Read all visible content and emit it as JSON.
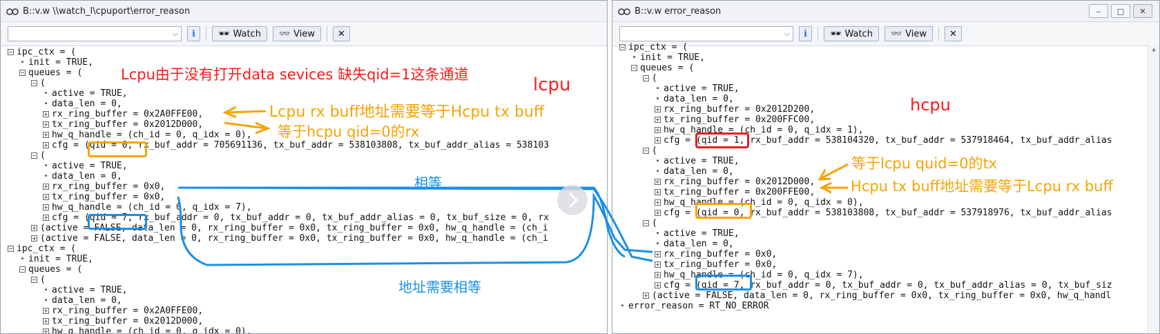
{
  "left_window": {
    "title": "B::v.w \\\\watch_l\\cpuport\\error_reason",
    "toolbar": {
      "watch_label": "Watch",
      "view_label": "View"
    },
    "lines": [
      {
        "d": 0,
        "m": "exp",
        "t": "ipc_ctx = ("
      },
      {
        "d": 1,
        "m": "dot",
        "t": "init = TRUE,"
      },
      {
        "d": 1,
        "m": "exp",
        "t": "queues = ("
      },
      {
        "d": 2,
        "m": "exp",
        "t": "("
      },
      {
        "d": 3,
        "m": "dot",
        "t": "active = TRUE,"
      },
      {
        "d": 3,
        "m": "dot",
        "t": "data_len = 0,"
      },
      {
        "d": 3,
        "m": "col",
        "t": "rx_ring_buffer = 0x2A0FFE00,"
      },
      {
        "d": 3,
        "m": "col",
        "t": "tx_ring_buffer = 0x2012D000,"
      },
      {
        "d": 3,
        "m": "col",
        "t": "hw_q_handle = (ch_id = 0, q_idx = 0),"
      },
      {
        "d": 3,
        "m": "col",
        "t": "cfg = (qid = 0, rx_buf_addr = 705691136, tx_buf_addr = 538103808, tx_buf_addr_alias = 538103"
      },
      {
        "d": 2,
        "m": "exp",
        "t": "("
      },
      {
        "d": 3,
        "m": "dot",
        "t": "active = TRUE,"
      },
      {
        "d": 3,
        "m": "dot",
        "t": "data_len = 0,"
      },
      {
        "d": 3,
        "m": "col",
        "t": "rx_ring_buffer = 0x0,"
      },
      {
        "d": 3,
        "m": "col",
        "t": "tx_ring_buffer = 0x0,"
      },
      {
        "d": 3,
        "m": "col",
        "t": "hw_q_handle = (ch_id = 0, q_idx = 7),"
      },
      {
        "d": 3,
        "m": "col",
        "t": "cfg = (qid = 7, rx_buf_addr = 0, tx_buf_addr = 0, tx_buf_addr_alias = 0, tx_buf_size = 0, rx"
      },
      {
        "d": 2,
        "m": "col",
        "t": "(active = FALSE, data_len = 0, rx_ring_buffer = 0x0, tx_ring_buffer = 0x0, hw_q_handle = (ch_i"
      },
      {
        "d": 2,
        "m": "col",
        "t": "(active = FALSE, data_len = 0, rx_ring_buffer = 0x0, tx_ring_buffer = 0x0, hw_q_handle = (ch_i"
      },
      {
        "d": 0,
        "m": "exp",
        "t": "ipc_ctx = ("
      },
      {
        "d": 1,
        "m": "dot",
        "t": "init = TRUE,"
      },
      {
        "d": 1,
        "m": "exp",
        "t": "queues = ("
      },
      {
        "d": 2,
        "m": "exp",
        "t": "("
      },
      {
        "d": 3,
        "m": "dot",
        "t": "active = TRUE,"
      },
      {
        "d": 3,
        "m": "dot",
        "t": "data_len = 0,"
      },
      {
        "d": 3,
        "m": "col",
        "t": "rx_ring_buffer = 0x2A0FFE00,"
      },
      {
        "d": 3,
        "m": "col",
        "t": "tx_ring_buffer = 0x2012D000,"
      },
      {
        "d": 3,
        "m": "col",
        "t": "hw_q_handle = (ch_id = 0, q_idx = 0),"
      }
    ]
  },
  "right_window": {
    "title": "B::v.w error_reason",
    "toolbar": {
      "watch_label": "Watch",
      "view_label": "View"
    },
    "lines": [
      {
        "d": 0,
        "m": "exp",
        "t": "ipc_ctx = ("
      },
      {
        "d": 1,
        "m": "dot",
        "t": "init = TRUE,"
      },
      {
        "d": 1,
        "m": "exp",
        "t": "queues = ("
      },
      {
        "d": 2,
        "m": "exp",
        "t": "("
      },
      {
        "d": 3,
        "m": "dot",
        "t": "active = TRUE,"
      },
      {
        "d": 3,
        "m": "dot",
        "t": "data_len = 0,"
      },
      {
        "d": 3,
        "m": "col",
        "t": "rx_ring_buffer = 0x2012D200,"
      },
      {
        "d": 3,
        "m": "col",
        "t": "tx_ring_buffer = 0x200FFC00,"
      },
      {
        "d": 3,
        "m": "col",
        "t": "hw_q_handle = (ch_id = 0, q_idx = 1),"
      },
      {
        "d": 3,
        "m": "col",
        "t": "cfg = (qid = 1, rx_buf_addr = 538104320, tx_buf_addr = 537918464, tx_buf_addr_alias"
      },
      {
        "d": 2,
        "m": "exp",
        "t": "("
      },
      {
        "d": 3,
        "m": "dot",
        "t": "active = TRUE,"
      },
      {
        "d": 3,
        "m": "dot",
        "t": "data_len = 0,"
      },
      {
        "d": 3,
        "m": "col",
        "t": "rx_ring_buffer = 0x2012D000,"
      },
      {
        "d": 3,
        "m": "col",
        "t": "tx_ring_buffer = 0x200FFE00,"
      },
      {
        "d": 3,
        "m": "col",
        "t": "hw_q_handle = (ch_id = 0, q_idx = 0),"
      },
      {
        "d": 3,
        "m": "col",
        "t": "cfg = (qid = 0, rx_buf_addr = 538103808, tx_buf_addr = 537918976, tx_buf_addr_alias"
      },
      {
        "d": 2,
        "m": "exp",
        "t": "("
      },
      {
        "d": 3,
        "m": "dot",
        "t": "active = TRUE,"
      },
      {
        "d": 3,
        "m": "dot",
        "t": "data_len = 0,"
      },
      {
        "d": 3,
        "m": "col",
        "t": "rx_ring_buffer = 0x0,"
      },
      {
        "d": 3,
        "m": "col",
        "t": "tx_ring_buffer = 0x0,"
      },
      {
        "d": 3,
        "m": "col",
        "t": "hw_q_handle = (ch_id = 0, q_idx = 7),"
      },
      {
        "d": 3,
        "m": "col",
        "t": "cfg = (qid = 7, rx_buf_addr = 0, tx_buf_addr = 0, tx_buf_addr_alias = 0, tx_buf_siz"
      },
      {
        "d": 2,
        "m": "col",
        "t": "(active = FALSE, data_len = 0, rx_ring_buffer = 0x0, tx_ring_buffer = 0x0, hw_q_handl"
      },
      {
        "d": 0,
        "m": "dot",
        "t": "error_reason = RT_NO_ERROR"
      }
    ]
  },
  "annotations": {
    "lcpu_missing": "Lcpu由于没有打开data sevices 缺失qid=1这条通道",
    "lcpu_label": "lcpu",
    "lcpu_rx_note": "Lcpu rx buff地址需要等于Hcpu tx buff",
    "lcpu_tx_note": "等于hcpu qid=0的rx",
    "equal_label": "相等",
    "addr_equal_label": "地址需要相等",
    "hcpu_label": "hcpu",
    "hcpu_rx_note": "等于lcpu quid=0的tx",
    "hcpu_tx_note": "Hcpu tx buff地址需要等于Lcpu rx buff"
  },
  "colors": {
    "red": "#ff1a1a",
    "orange": "#f5a400",
    "blue": "#1a8fe8",
    "box_red": "#e02020"
  }
}
